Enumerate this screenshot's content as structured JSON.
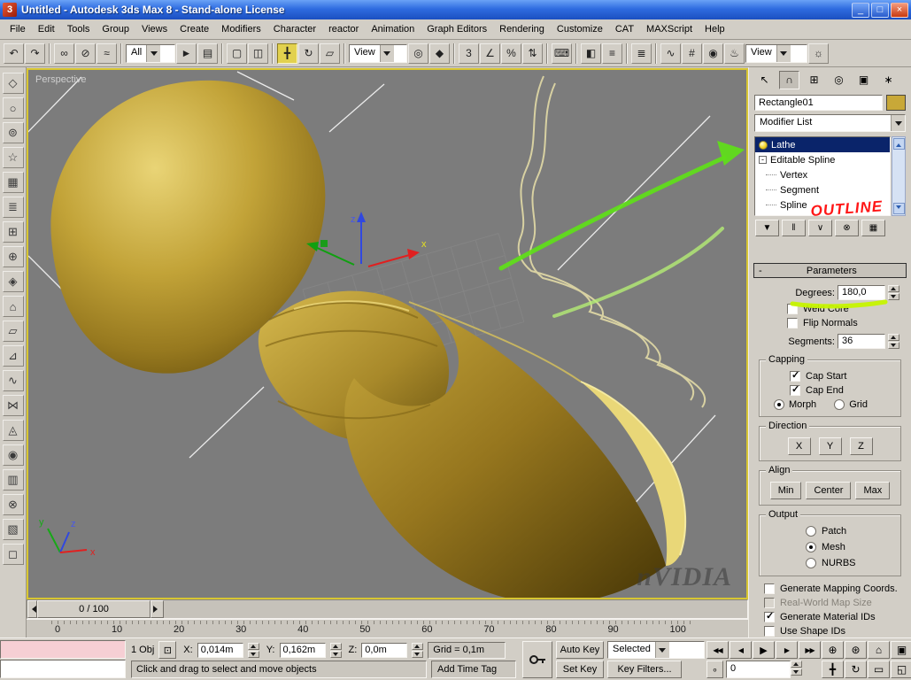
{
  "window": {
    "title": "Untitled - Autodesk 3ds Max 8 - Stand-alone License",
    "app_glyph": "3",
    "minimize": "_",
    "maximize": "□",
    "close": "×"
  },
  "menu": {
    "items": [
      "File",
      "Edit",
      "Tools",
      "Group",
      "Views",
      "Create",
      "Modifiers",
      "Character",
      "reactor",
      "Animation",
      "Graph Editors",
      "Rendering",
      "Customize",
      "CAT",
      "MAXScript",
      "Help"
    ]
  },
  "toolbar": {
    "selection_filter": "All",
    "coordinate_system": "View",
    "render_type": "View",
    "icons": {
      "undo": "↶",
      "redo": "↷",
      "select_link": "∞",
      "unlink": "⊘",
      "bind_spacewarp": "≈",
      "select": "►",
      "select_by_name": "▤",
      "region": "▢",
      "window_crossing": "◫",
      "move": "╋",
      "rotate": "↻",
      "scale": "▱",
      "use_center": "◎",
      "manipulate": "◆",
      "snap_3d": "3",
      "snap_angle": "∠",
      "snap_percent": "%",
      "snap_spinner": "⇅",
      "keyboard_override": "⌨",
      "mirror": "◧",
      "align": "≡",
      "layer_manager": "≣",
      "curve_editor": "∿",
      "schematic_view": "#",
      "material_editor": "◉",
      "render_scene": "♨",
      "quick_render": "☼"
    }
  },
  "left_toolbar": {
    "icons": [
      "◇",
      "○",
      "⊚",
      "☆",
      "▦",
      "≣",
      "⊞",
      "⊕",
      "◈",
      "⌂",
      "▱",
      "⊿",
      "∿",
      "⋈",
      "◬",
      "◉",
      "▥",
      "⊗",
      "▧",
      "◻"
    ]
  },
  "viewport": {
    "label": "Perspective",
    "watermark": "nVIDIA",
    "gizmo_x": "x",
    "gizmo_z": "z",
    "axis_x": "x",
    "axis_y": "y",
    "axis_z": "z"
  },
  "timeline": {
    "slider": "0 / 100",
    "ticks": [
      "0",
      "10",
      "20",
      "30",
      "40",
      "50",
      "60",
      "70",
      "80",
      "90",
      "100"
    ]
  },
  "command_panel": {
    "tabs": {
      "create": "↖",
      "modify": "∩",
      "hierarchy": "⊞",
      "motion": "◎",
      "display": "▣",
      "utilities": "∗"
    },
    "object_name": "Rectangle01",
    "modifier_list": "Modifier List",
    "stack_minus": "-",
    "stack": {
      "items": [
        "Lathe",
        "Editable Spline",
        "Vertex",
        "Segment",
        "Spline"
      ]
    },
    "stack_buttons": [
      "▼",
      "‖",
      "∨",
      "⊗",
      "▦"
    ],
    "parameters": {
      "collapse": "-",
      "title": "Parameters",
      "degrees_label": "Degrees:",
      "degrees": "180,0",
      "weld_core": "Weld Core",
      "flip_normals": "Flip Normals",
      "segments_label": "Segments:",
      "segments": "36",
      "capping_title": "Capping",
      "cap_start": "Cap Start",
      "cap_end": "Cap End",
      "morph": "Morph",
      "grid": "Grid",
      "direction_title": "Direction",
      "dir_x": "X",
      "dir_y": "Y",
      "dir_z": "Z",
      "align_title": "Align",
      "min": "Min",
      "center": "Center",
      "max": "Max",
      "output_title": "Output",
      "patch": "Patch",
      "mesh": "Mesh",
      "nurbs": "NURBS",
      "gen_mapping": "Generate Mapping Coords.",
      "real_world": "Real-World Map Size",
      "gen_material": "Generate Material IDs",
      "use_shape": "Use Shape IDs"
    }
  },
  "status": {
    "object_count": "1 Obj",
    "x_label": "X:",
    "x": "0,014m",
    "y_label": "Y:",
    "y": "0,162m",
    "z_label": "Z:",
    "z": "0,0m",
    "grid": "Grid = 0,1m",
    "prompt": "Click and drag to select and move objects",
    "add_time_tag": "Add Time Tag",
    "auto_key": "Auto Key",
    "set_key": "Set Key",
    "selected": "Selected",
    "key_filters": "Key Filters...",
    "frame": "0",
    "icons": {
      "lock": "⊡",
      "key_toggle": "∘",
      "playback": [
        "◀◀",
        "◀",
        "▶",
        "▶",
        "▶▶"
      ],
      "nav": [
        "⊕",
        "⊛",
        "⌂",
        "▣",
        "╋",
        "↻",
        "▭",
        "◱"
      ]
    }
  },
  "annotations": {
    "outline": "OUTLINE"
  },
  "colors": {
    "viewport_bg": "#7c7c7c",
    "object_gold": "#b8962e",
    "selection_highlight": "#0a246a",
    "annotation_green": "#5ee018",
    "annotation_red": "#ff1616",
    "active_viewport_border": "#d8c632",
    "object_color_swatch": "#c8a838"
  }
}
